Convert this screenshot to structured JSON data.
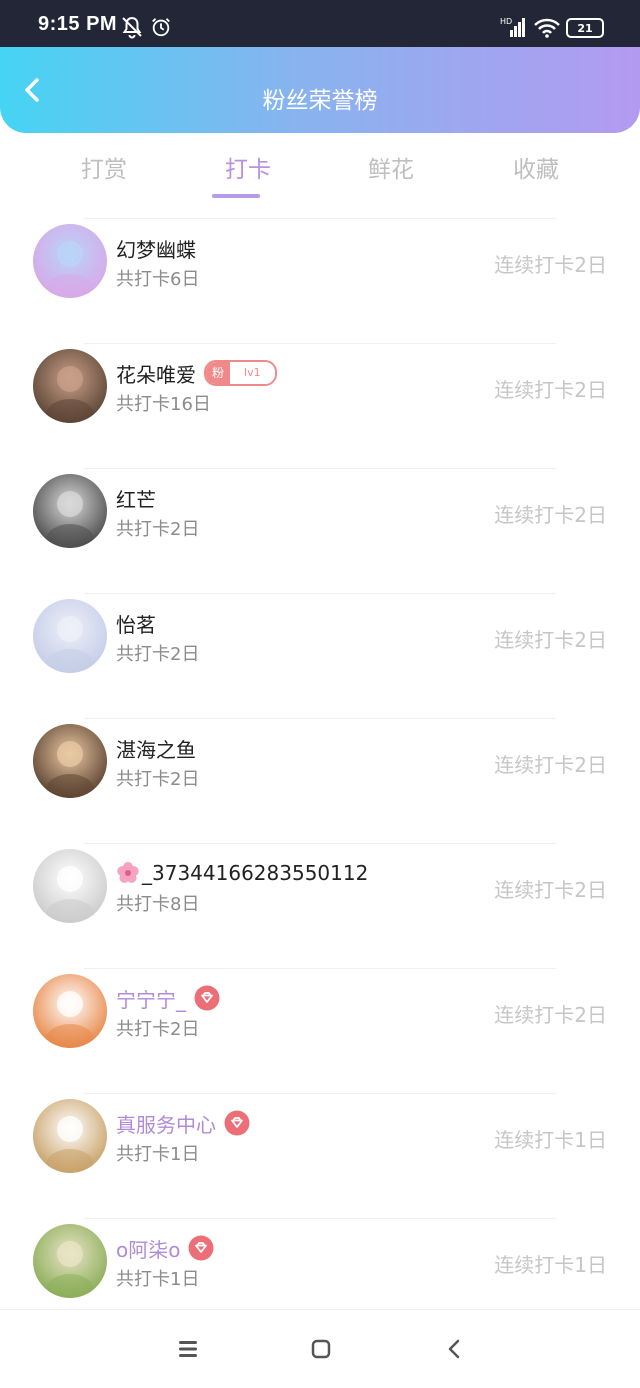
{
  "status_bar": {
    "time": "9:15 PM",
    "battery": "21"
  },
  "header": {
    "title": "粉丝荣誉榜"
  },
  "tabs": [
    {
      "label": "打赏",
      "active": false
    },
    {
      "label": "打卡",
      "active": true
    },
    {
      "label": "鲜花",
      "active": false
    },
    {
      "label": "收藏",
      "active": false
    }
  ],
  "fans": [
    {
      "name": "幻梦幽蝶",
      "total": "共打卡6日",
      "streak": "连续打卡2日",
      "vip": false,
      "avatar_colors": [
        "#b9d4f7",
        "#d7a9e8"
      ]
    },
    {
      "name": "花朵唯爱",
      "total": "共打卡16日",
      "streak": "连续打卡2日",
      "vip": false,
      "badge": {
        "label": "粉",
        "level": "lv1"
      },
      "avatar_colors": [
        "#c9a08a",
        "#5d4636"
      ]
    },
    {
      "name": "红芒",
      "total": "共打卡2日",
      "streak": "连续打卡2日",
      "vip": false,
      "avatar_colors": [
        "#d9d9d9",
        "#4f4f4f"
      ]
    },
    {
      "name": "怡茗",
      "total": "共打卡2日",
      "streak": "连续打卡2日",
      "vip": false,
      "avatar_colors": [
        "#eef0f8",
        "#c5cde8"
      ]
    },
    {
      "name": "湛海之鱼",
      "total": "共打卡2日",
      "streak": "连续打卡2日",
      "vip": false,
      "avatar_colors": [
        "#e9c9a4",
        "#5f4533"
      ]
    },
    {
      "name": "_37344166283550112",
      "total": "共打卡8日",
      "streak": "连续打卡2日",
      "vip": false,
      "flower_prefix": true,
      "avatar_colors": [
        "#ffffff",
        "#cccccc"
      ]
    },
    {
      "name": "宁宁宁_",
      "total": "共打卡2日",
      "streak": "连续打卡2日",
      "vip": true,
      "gem": true,
      "avatar_colors": [
        "#ffffff",
        "#e8894a"
      ]
    },
    {
      "name": "真服务中心",
      "total": "共打卡1日",
      "streak": "连续打卡1日",
      "vip": true,
      "gem": true,
      "avatar_colors": [
        "#ffffff",
        "#c9a36a"
      ]
    },
    {
      "name": "o阿柒o",
      "total": "共打卡1日",
      "streak": "连续打卡1日",
      "vip": true,
      "gem": true,
      "avatar_colors": [
        "#e9e4c6",
        "#8cae5a"
      ]
    }
  ],
  "colors": {
    "accent": "#b891e0",
    "badge": "#f08a8a",
    "gem": "#ec6f78"
  }
}
